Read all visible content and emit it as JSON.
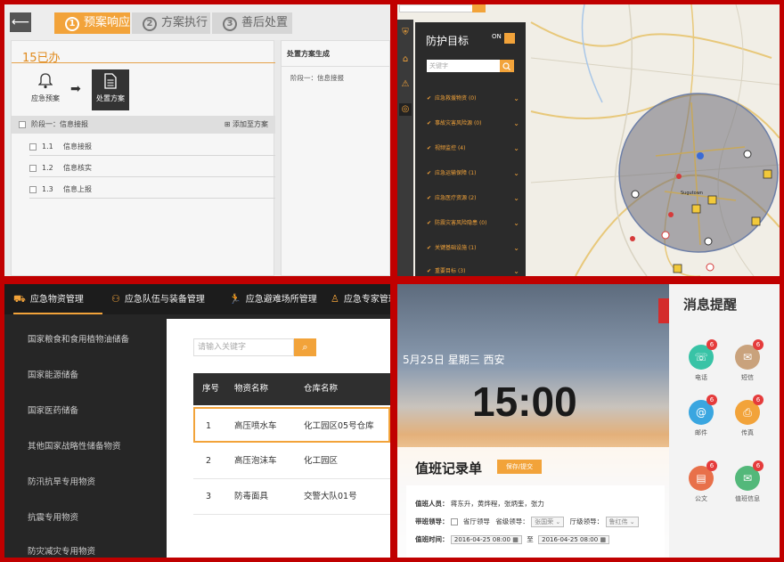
{
  "q1": {
    "back_icon": "arrow-left-icon",
    "steps": [
      {
        "num": "1",
        "label": "预案响应"
      },
      {
        "num": "2",
        "label": "方案执行"
      },
      {
        "num": "3",
        "label": "善后处置"
      }
    ],
    "pending_label": "15已办",
    "actions": [
      {
        "label": "应急预案",
        "icon": "bell-icon"
      },
      {
        "label": "处置方案",
        "icon": "document-icon"
      }
    ],
    "group_header": "阶段一：信息接报",
    "add_plan_label": "添加至方案",
    "tasks": [
      {
        "num": "1.1",
        "label": "信息接报"
      },
      {
        "num": "1.2",
        "label": "信息核实"
      },
      {
        "num": "1.3",
        "label": "信息上报"
      }
    ],
    "right_title": "处置方案生成",
    "right_item": "阶段一：信息接报"
  },
  "q2": {
    "panel_title": "防护目标",
    "toggle_label": "ON",
    "search_placeholder": "关键字",
    "items": [
      "应急救援物资 (0)",
      "事故灾害风险源 (0)",
      "视频监控 (4)",
      "应急运输保障 (1)",
      "应急医疗资源 (2)",
      "防震灾害风险隐患 (0)",
      "关键基础设施 (1)",
      "重要目标 (3)"
    ],
    "nav_icons": [
      "shield-icon",
      "home-icon",
      "warning-icon",
      "target-icon"
    ],
    "map_label": "Sugutown"
  },
  "q3": {
    "tabs": [
      {
        "label": "应急物资管理",
        "icon": "truck-icon"
      },
      {
        "label": "应急队伍与装备管理",
        "icon": "team-icon"
      },
      {
        "label": "应急避难场所管理",
        "icon": "runner-icon"
      },
      {
        "label": "应急专家管理",
        "icon": "expert-icon"
      }
    ],
    "side_items": [
      "国家粮食和食用植物油储备",
      "国家能源储备",
      "国家医药储备",
      "其他国家战略性储备物资",
      "防汛抗旱专用物资",
      "抗震专用物资",
      "防灾减灾专用物资"
    ],
    "search_placeholder": "请输入关键字",
    "table_headers": [
      "序号",
      "物资名称",
      "仓库名称"
    ],
    "rows": [
      {
        "no": "1",
        "name": "高压喷水车",
        "warehouse": "化工园区05号仓库"
      },
      {
        "no": "2",
        "name": "高压泡沫车",
        "warehouse": "化工园区"
      },
      {
        "no": "3",
        "name": "防毒面具",
        "warehouse": "交警大队01号"
      }
    ]
  },
  "q4": {
    "date_line": "5月25日   星期三   西安",
    "clock": "15:00",
    "record_title": "值班记录单",
    "record_btn": "保存/提交",
    "duty_label": "值班人员：",
    "duty_value": "蒋东升，黄烨程，张炳奎，张力",
    "leader_label": "带班领导：",
    "leader_opt1": "省厅领导",
    "leader_opt2": "省级领导：",
    "leader_sel1": "张国荣",
    "leader_opt3": "厅级领导：",
    "leader_sel2": "鲁红伟",
    "time_label": "值班时间：",
    "time_start": "2016-04-25  08:00",
    "time_sep": "至",
    "time_end": "2016-04-25  08:00",
    "msg_title": "消息提醒",
    "messages": [
      {
        "label": "电话",
        "badge": "6",
        "color": "#38c3a6",
        "icon": "phone-icon"
      },
      {
        "label": "短信",
        "badge": "6",
        "color": "#c9a27c",
        "icon": "chat-icon"
      },
      {
        "label": "邮件",
        "badge": "6",
        "color": "#3aa6e0",
        "icon": "mail-icon"
      },
      {
        "label": "传真",
        "badge": "6",
        "color": "#f2a33a",
        "icon": "fax-icon"
      },
      {
        "label": "公文",
        "badge": "6",
        "color": "#e8704a",
        "icon": "doc-icon"
      },
      {
        "label": "值班信息",
        "badge": "6",
        "color": "#53b87a",
        "icon": "envelope-icon"
      }
    ]
  }
}
